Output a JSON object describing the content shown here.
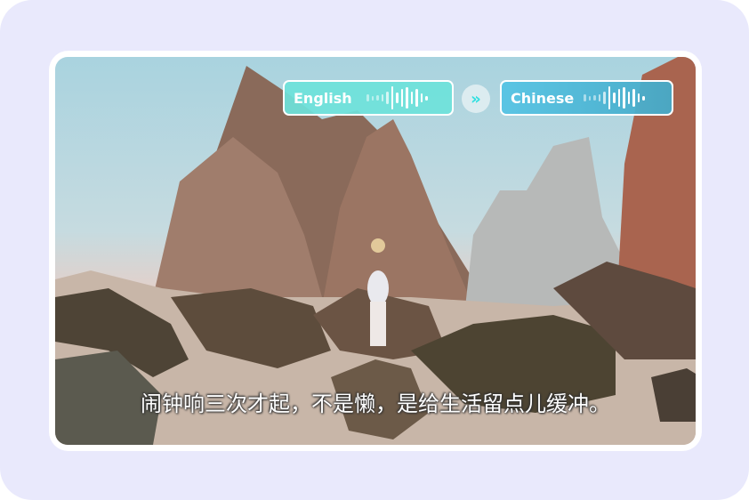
{
  "translation": {
    "source_language": "English",
    "target_language": "Chinese",
    "swap_icon": "double-chevron-right-icon"
  },
  "subtitle": "闹钟响三次才起，不是懒，是给生活留点儿缓冲。",
  "colors": {
    "background": "#e9e9fc",
    "source_chip": "#6ee2da",
    "target_chip": "#56c4e4",
    "arrow": "#2fe0e0"
  }
}
